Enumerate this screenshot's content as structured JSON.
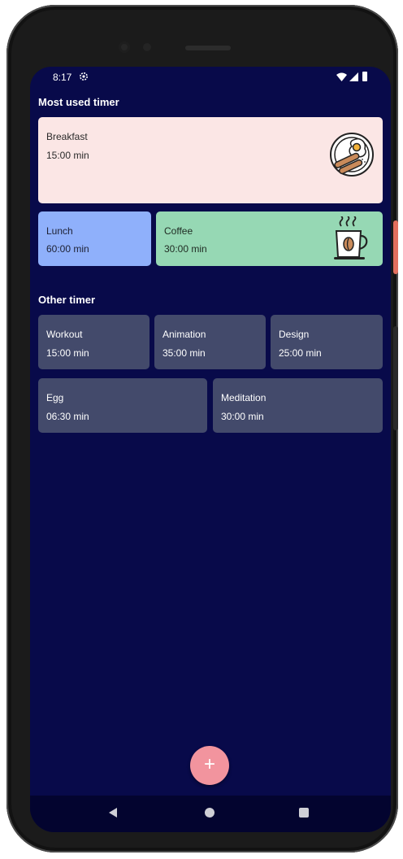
{
  "status_bar": {
    "time": "8:17"
  },
  "sections": {
    "most_used_title": "Most used timer",
    "other_title": "Other timer"
  },
  "most_used": [
    {
      "name": "Breakfast",
      "duration": "15:00 min",
      "color": "#fbe6e5",
      "icon": "breakfast-plate-icon"
    },
    {
      "name": "Lunch",
      "duration": "60:00 min",
      "color": "#8fb0fb"
    },
    {
      "name": "Coffee",
      "duration": "30:00 min",
      "color": "#96d8b4",
      "icon": "coffee-cup-icon"
    }
  ],
  "other": [
    {
      "name": "Workout",
      "duration": "15:00 min"
    },
    {
      "name": "Animation",
      "duration": "35:00 min"
    },
    {
      "name": "Design",
      "duration": "25:00 min"
    },
    {
      "name": "Egg",
      "duration": "06:30 min"
    },
    {
      "name": "Meditation",
      "duration": "30:00 min"
    }
  ],
  "fab": {
    "label": "+",
    "color": "#f2949e"
  },
  "colors": {
    "background": "#080a4a",
    "card_other": "#434a6b"
  }
}
